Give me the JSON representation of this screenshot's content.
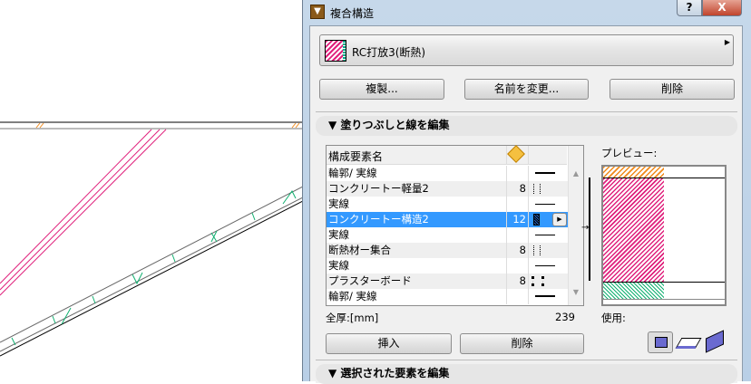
{
  "dialog": {
    "title": "複合構造",
    "help": "?",
    "close": "X"
  },
  "composite": {
    "name": "RC打放3(断熱)"
  },
  "buttons": {
    "duplicate": "複製...",
    "rename": "名前を変更...",
    "delete": "削除",
    "insert": "挿入",
    "delete_row": "削除"
  },
  "sections": {
    "fill_lines": "塗りつぶしと線を編集",
    "selected": "選択された要素を編集"
  },
  "table": {
    "header": "構成要素名",
    "rows": [
      {
        "name": " 輪郭/ 実線",
        "num": "",
        "line": "thick"
      },
      {
        "name": "コンクリートー軽量2",
        "num": "8",
        "line": "dots"
      },
      {
        "name": " 実線",
        "num": "",
        "line": "thin"
      },
      {
        "name": "コンクリートー構造2",
        "num": "12",
        "line": "block",
        "selected": true
      },
      {
        "name": " 実線",
        "num": "",
        "line": "thin"
      },
      {
        "name": "断熱材ー集合",
        "num": "8",
        "line": "dots"
      },
      {
        "name": " 実線",
        "num": "",
        "line": "thin"
      },
      {
        "name": "プラスターボード",
        "num": "8",
        "line": "bars"
      },
      {
        "name": " 輪郭/ 実線",
        "num": "",
        "line": "thick"
      }
    ]
  },
  "total": {
    "label": "全厚:[mm]",
    "value": "239"
  },
  "preview": {
    "label": "プレビュー:",
    "use_label": "使用:"
  },
  "colors": {
    "pink": "#e0207c",
    "orange": "#f08a1a",
    "green": "#10b070",
    "select": "#3399ff"
  }
}
